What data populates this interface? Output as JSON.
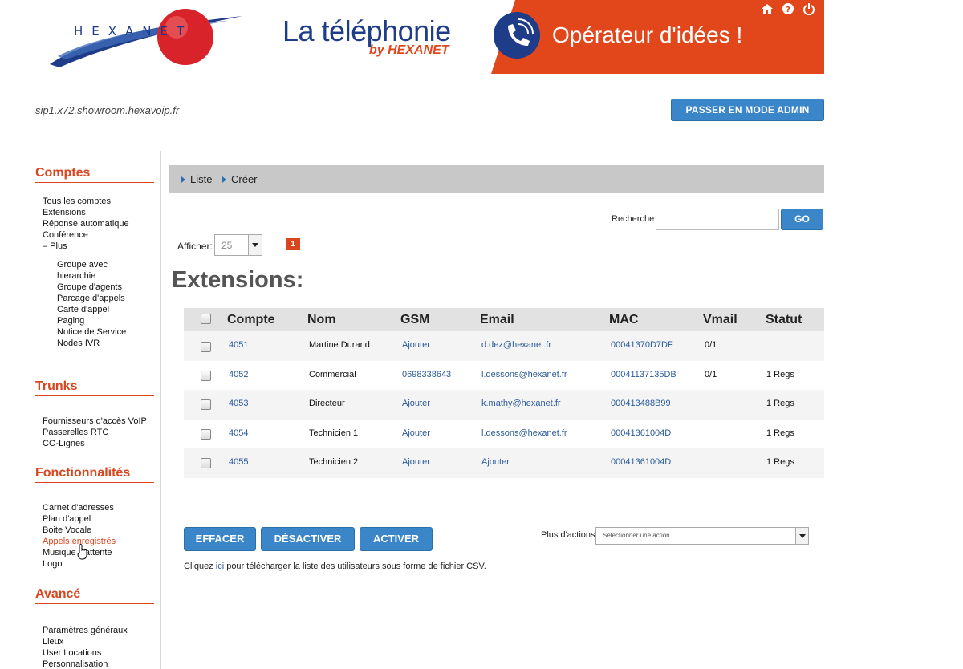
{
  "header": {
    "logo_text": "HEXANET",
    "banner_title": "La téléphonie",
    "banner_by": "by HEXANET",
    "banner_slogan": "Opérateur d'idées !",
    "accent_color": "#e2461b",
    "brand_color": "#1f3c88",
    "icons": [
      "home-icon",
      "help-icon",
      "power-icon"
    ]
  },
  "hostname": "sip1.x72.showroom.hexavoip.fr",
  "admin_button": "PASSER EN MODE ADMIN",
  "sidebar": {
    "comptes": {
      "title": "Comptes",
      "items": [
        "Tous les comptes",
        "Extensions",
        "Réponse automatique",
        "Conférence",
        "– Plus"
      ],
      "subitems": [
        "Groupe avec",
        "hierarchie",
        "Groupe d'agents",
        "Parcage d'appels",
        "Carte d'appel",
        "Paging",
        "Notice de Service",
        "Nodes IVR"
      ]
    },
    "trunks": {
      "title": "Trunks",
      "items": [
        "Fournisseurs d'accès VoIP",
        "Passerelles RTC",
        "CO-Lignes"
      ]
    },
    "fonctionnalites": {
      "title": "Fonctionnalités",
      "items": [
        "Carnet d'adresses",
        "Plan d'appel",
        "Boite Vocale",
        "Appels enregistrés",
        "Musique d'attente",
        "Logo"
      ]
    },
    "avance": {
      "title": "Avancé",
      "items": [
        "Paramètres généraux",
        "Lieux",
        "User Locations",
        "Personnalisation"
      ]
    }
  },
  "tabs": [
    "Liste",
    "Créer"
  ],
  "search": {
    "label": "Recherche",
    "value": "",
    "button": "GO"
  },
  "pagination": {
    "label": "Afficher:",
    "page_size": "25",
    "current_page": "1"
  },
  "page_title": "Extensions:",
  "table": {
    "headers": [
      "Compte",
      "Nom",
      "GSM",
      "Email",
      "MAC",
      "Vmail",
      "Statut"
    ],
    "rows": [
      {
        "compte": "4051",
        "nom": "Martine Durand",
        "gsm": "Ajouter",
        "email": "d.dez@hexanet.fr",
        "mac": "00041370D7DF",
        "vmail": "0/1",
        "statut": ""
      },
      {
        "compte": "4052",
        "nom": "Commercial",
        "gsm": "0698338643",
        "email": "l.dessons@hexanet.fr",
        "mac": "00041137135DB",
        "vmail": "0/1",
        "statut": "1 Regs"
      },
      {
        "compte": "4053",
        "nom": "Directeur",
        "gsm": "Ajouter",
        "email": "k.mathy@hexanet.fr",
        "mac": "000413488B99",
        "vmail": "",
        "statut": "1 Regs"
      },
      {
        "compte": "4054",
        "nom": "Technicien 1",
        "gsm": "Ajouter",
        "email": "l.dessons@hexanet.fr",
        "mac": "00041361004D",
        "vmail": "",
        "statut": "1 Regs"
      },
      {
        "compte": "4055",
        "nom": "Technicien 2",
        "gsm": "Ajouter",
        "email": "Ajouter",
        "mac": "00041361004D",
        "vmail": "",
        "statut": "1 Regs"
      }
    ]
  },
  "actions": {
    "buttons": [
      "EFFACER",
      "DÉSACTIVER",
      "ACTIVER"
    ],
    "more_label": "Plus d'actions:",
    "more_placeholder": "Sélectionner une action"
  },
  "csv_note": {
    "before": "Cliquez ",
    "link": "ici",
    "after": " pour télécharger la liste des utilisateurs sous forme de fichier CSV."
  }
}
